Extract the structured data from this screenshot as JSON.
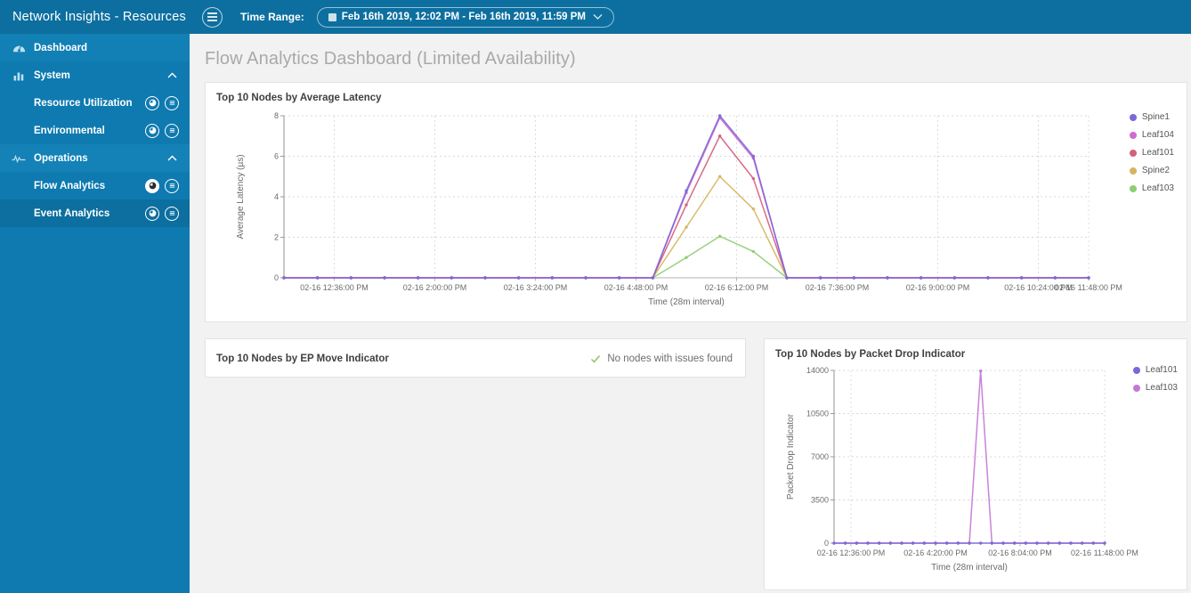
{
  "sidebar": {
    "title": "Network Insights - Resources",
    "items": [
      {
        "label": "Dashboard",
        "icon": "gauge-icon",
        "level": 0,
        "expandable": false
      },
      {
        "label": "System",
        "icon": "bar-chart-icon",
        "level": 0,
        "expandable": true,
        "expanded": true
      },
      {
        "label": "Resource Utilization",
        "level": 1,
        "icons": [
          "dashboard-circle-icon",
          "list-circle-icon"
        ],
        "active": false
      },
      {
        "label": "Environmental",
        "level": 1,
        "icons": [
          "dashboard-circle-icon",
          "list-circle-icon"
        ],
        "active": false
      },
      {
        "label": "Operations",
        "icon": "pulse-icon",
        "level": 0,
        "expandable": true,
        "expanded": true
      },
      {
        "label": "Flow Analytics",
        "level": 1,
        "icons": [
          "dashboard-circle-icon",
          "list-circle-icon"
        ],
        "active": true
      },
      {
        "label": "Event Analytics",
        "level": 1,
        "icons": [
          "dashboard-circle-icon",
          "list-circle-icon"
        ],
        "active": false
      }
    ]
  },
  "topbar": {
    "menu_icon": "hamburger-icon",
    "time_range_label": "Time Range:",
    "time_range_value": "Feb 16th 2019, 12:02 PM - Feb 16th 2019, 11:59 PM",
    "calendar_icon": "calendar-icon",
    "caret_icon": "chevron-down-icon"
  },
  "page": {
    "title": "Flow Analytics Dashboard (Limited Availability)"
  },
  "cards": {
    "latency": {
      "title": "Top 10 Nodes by Average Latency"
    },
    "epmove": {
      "title": "Top 10 Nodes by EP Move Indicator",
      "status_text": "No nodes with issues found",
      "status_icon": "check-icon",
      "status_color": "#8cc152"
    },
    "drop": {
      "title": "Top 10 Nodes by Packet Drop Indicator"
    }
  },
  "chart_data": [
    {
      "id": "latency",
      "type": "line",
      "title": "Top 10 Nodes by Average Latency",
      "xlabel": "Time (28m interval)",
      "ylabel": "Average Latency (µs)",
      "ylim": [
        0,
        8
      ],
      "yticks": [
        0,
        2,
        4,
        6,
        8
      ],
      "ytick_labels": [
        "0",
        "2",
        "4",
        "6",
        "8"
      ],
      "grid": true,
      "legend_position": "right",
      "xtick_labels": [
        "02-16 12:36:00 PM",
        "02-16 2:00:00 PM",
        "02-16 3:24:00 PM",
        "02-16 4:48:00 PM",
        "02-16 6:12:00 PM",
        "02-16 7:36:00 PM",
        "02-16 9:00:00 PM",
        "02-16 10:24:00 PM",
        "02-16 11:48:00 PM"
      ],
      "xtick_positions": [
        0.0625,
        0.1875,
        0.3125,
        0.4375,
        0.5625,
        0.6875,
        0.8125,
        0.9375,
        1.0
      ],
      "x": [
        0,
        1,
        2,
        3,
        4,
        5,
        6,
        7,
        8,
        9,
        10,
        11,
        12,
        13,
        14,
        15,
        16,
        17,
        18,
        19,
        20,
        21,
        22,
        23,
        24
      ],
      "series": [
        {
          "name": "Spine1",
          "color": "#7b68d6",
          "values": [
            0,
            0,
            0,
            0,
            0,
            0,
            0,
            0,
            0,
            0,
            0,
            0,
            4.3,
            8.0,
            6.0,
            0,
            0,
            0,
            0,
            0,
            0,
            0,
            0,
            0,
            0
          ]
        },
        {
          "name": "Leaf104",
          "color": "#d06bd0",
          "values": [
            0,
            0,
            0,
            0,
            0,
            0,
            0,
            0,
            0,
            0,
            0,
            0,
            4.2,
            7.9,
            5.9,
            0,
            0,
            0,
            0,
            0,
            0,
            0,
            0,
            0,
            0
          ]
        },
        {
          "name": "Leaf101",
          "color": "#d4607e",
          "values": [
            0,
            0,
            0,
            0,
            0,
            0,
            0,
            0,
            0,
            0,
            0,
            0,
            3.6,
            7.0,
            4.9,
            0,
            0,
            0,
            0,
            0,
            0,
            0,
            0,
            0,
            0
          ]
        },
        {
          "name": "Spine2",
          "color": "#d6b55f",
          "values": [
            0,
            0,
            0,
            0,
            0,
            0,
            0,
            0,
            0,
            0,
            0,
            0,
            2.5,
            5.0,
            3.4,
            0,
            0,
            0,
            0,
            0,
            0,
            0,
            0,
            0,
            0
          ]
        },
        {
          "name": "Leaf103",
          "color": "#8fce73",
          "values": [
            0,
            0,
            0,
            0,
            0,
            0,
            0,
            0,
            0,
            0,
            0,
            0,
            1.0,
            2.05,
            1.3,
            0,
            0,
            0,
            0,
            0,
            0,
            0,
            0,
            0,
            0
          ]
        }
      ]
    },
    {
      "id": "drop",
      "type": "line",
      "title": "Top 10 Nodes by Packet Drop Indicator",
      "xlabel": "Time (28m interval)",
      "ylabel": "Packet Drop Indicator",
      "ylim": [
        0,
        14000
      ],
      "yticks": [
        0,
        3500,
        7000,
        10500,
        14000
      ],
      "ytick_labels": [
        "0",
        "3500",
        "7000",
        "10500",
        "14000"
      ],
      "grid": true,
      "legend_position": "right",
      "xtick_labels": [
        "02-16 12:36:00 PM",
        "02-16 4:20:00 PM",
        "02-16 8:04:00 PM",
        "02-16 11:48:00 PM"
      ],
      "xtick_positions": [
        0.0625,
        0.375,
        0.6875,
        1.0
      ],
      "x": [
        0,
        1,
        2,
        3,
        4,
        5,
        6,
        7,
        8,
        9,
        10,
        11,
        12,
        13,
        14,
        15,
        16,
        17,
        18,
        19,
        20,
        21,
        22,
        23,
        24
      ],
      "series": [
        {
          "name": "Leaf101",
          "color": "#7b68d6",
          "values": [
            0,
            0,
            0,
            0,
            0,
            0,
            0,
            0,
            0,
            0,
            0,
            0,
            0,
            0,
            0,
            0,
            0,
            0,
            0,
            0,
            0,
            0,
            0,
            0,
            0
          ]
        },
        {
          "name": "Leaf103",
          "color": "#c478d6",
          "values": [
            0,
            0,
            0,
            0,
            0,
            0,
            0,
            0,
            0,
            0,
            0,
            0,
            0,
            13950,
            0,
            0,
            0,
            0,
            0,
            0,
            0,
            0,
            0,
            0,
            0
          ]
        }
      ]
    }
  ]
}
